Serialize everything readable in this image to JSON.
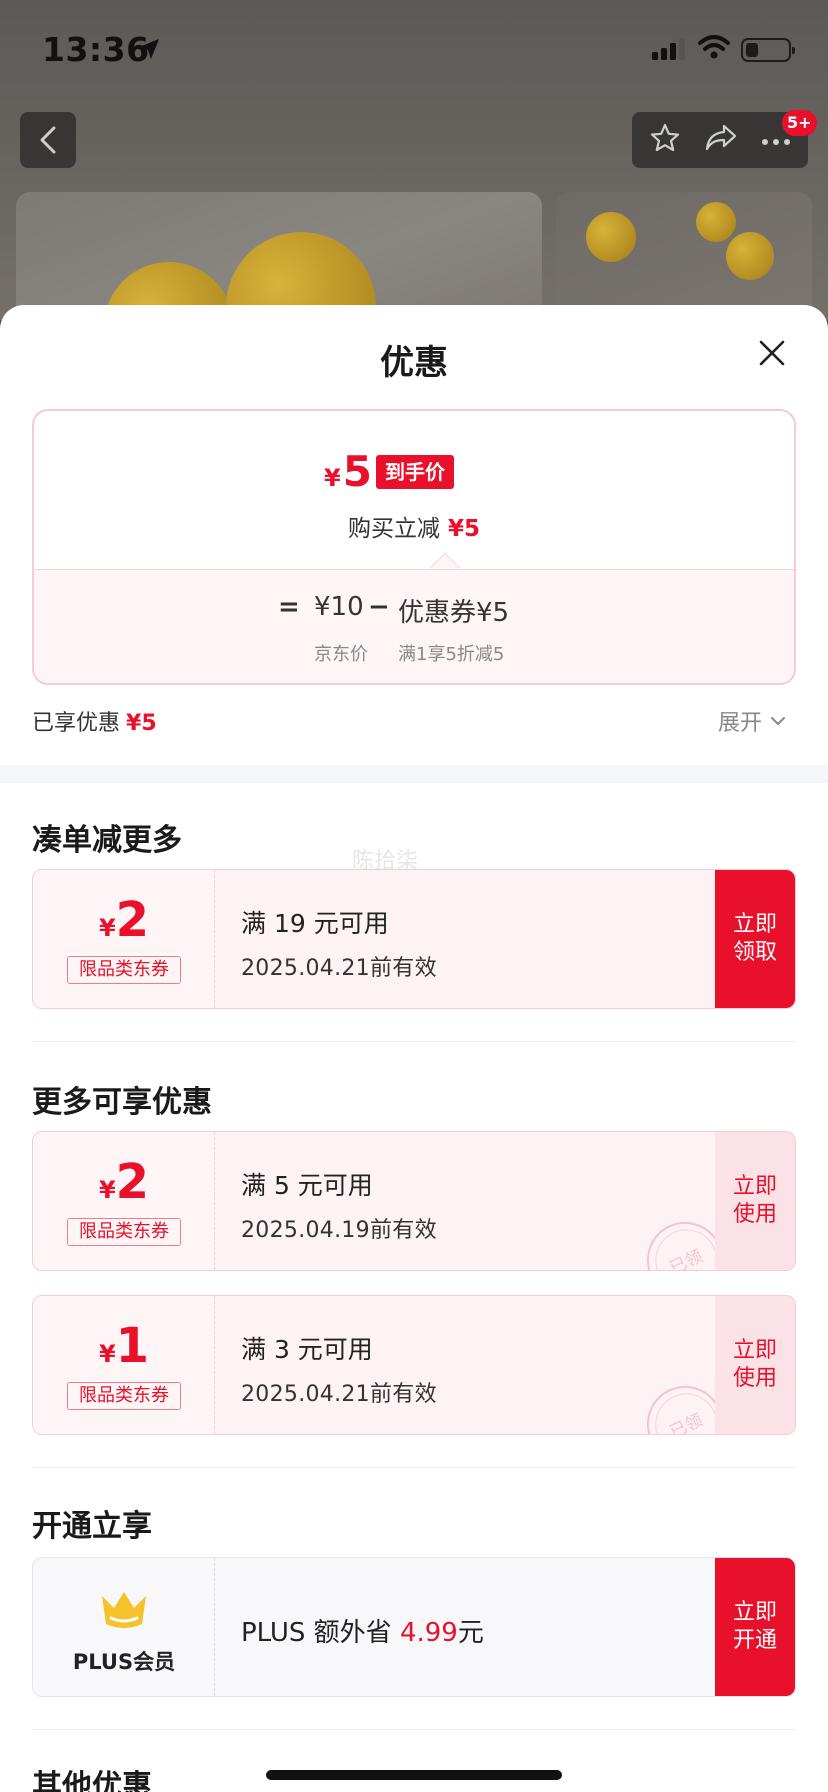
{
  "status_bar": {
    "time": "13:36"
  },
  "header": {
    "notification_badge": "5+"
  },
  "sheet": {
    "title": "优惠"
  },
  "price_card": {
    "yen": "¥",
    "final_price": "5",
    "final_tag": "到手价",
    "instant_label": "购买立减",
    "instant_amount": "¥5",
    "equals": "=",
    "jd_price": "¥10",
    "minus": "−",
    "coupon_term": "优惠券¥5",
    "jd_price_label": "京东价",
    "coupon_rule": "满1享5折减5"
  },
  "enjoyed": {
    "label": "已享优惠",
    "amount": "¥5",
    "expand_label": "展开"
  },
  "section_combine": {
    "title": "凑单减更多",
    "watermark": "陈拾柒",
    "coupons": [
      {
        "yen": "¥",
        "amount": "2",
        "type": "限品类东券",
        "condition": "满 19 元可用",
        "expiry": "2025.04.21前有效",
        "button": "立即 领取"
      }
    ]
  },
  "section_more": {
    "title": "更多可享优惠",
    "coupons": [
      {
        "yen": "¥",
        "amount": "2",
        "type": "限品类东券",
        "condition": "满 5 元可用",
        "expiry": "2025.04.19前有效",
        "button": "立即 使用",
        "stamp": "已领"
      },
      {
        "yen": "¥",
        "amount": "1",
        "type": "限品类东券",
        "condition": "满 3 元可用",
        "expiry": "2025.04.21前有效",
        "button": "立即 使用",
        "stamp": "已领"
      }
    ]
  },
  "section_plus": {
    "title": "开通立享",
    "label": "PLUS会员",
    "text_prefix": "PLUS 额外省",
    "saving": "4.99",
    "text_suffix": "元",
    "button": "立即 开通"
  },
  "section_other": {
    "title": "其他优惠"
  },
  "colors": {
    "accent_red": "#e8102a",
    "pink_bg": "#fdf2f4",
    "crown_gold": "#f6c22b"
  }
}
